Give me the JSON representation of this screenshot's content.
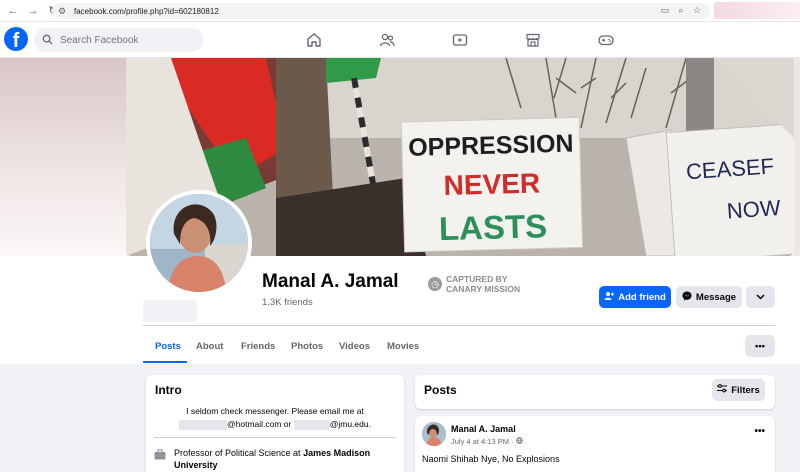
{
  "browser": {
    "url": "facebook.com/profile.php?id=602180812"
  },
  "fbnav": {
    "logo": "f",
    "search_placeholder": "Search Facebook"
  },
  "cover": {
    "sign_main": [
      "OPPRESSION",
      "NEVER",
      "LASTS"
    ],
    "sign_right": [
      "CEASEF",
      "NOW"
    ]
  },
  "profile": {
    "name": "Manal A. Jamal",
    "friends": "1.3K friends",
    "captured_line1": "CAPTURED BY",
    "captured_line2": "CANARY MISSION",
    "add_friend": "Add friend",
    "message": "Message"
  },
  "tabs": [
    {
      "label": "Posts"
    },
    {
      "label": "About"
    },
    {
      "label": "Friends"
    },
    {
      "label": "Photos"
    },
    {
      "label": "Videos"
    },
    {
      "label": "Movies"
    }
  ],
  "intro": {
    "title": "Intro",
    "bio_line1": "I seldom check messenger. Please email me at",
    "bio_email1_suffix": "@hotmail.com or",
    "bio_email2_suffix": "@jmu.edu.",
    "work_prefix": "Professor of Political Science at",
    "work_place": "James Madison University"
  },
  "posts_header": {
    "title": "Posts",
    "filters": "Filters"
  },
  "post": {
    "author": "Manal A. Jamal",
    "meta": "July 4 at 4:13 PM ·",
    "text": "Naomi Shihab Nye, No Explosions"
  },
  "colors": {
    "brand": "#0866ff",
    "background": "#f0f2f5"
  }
}
